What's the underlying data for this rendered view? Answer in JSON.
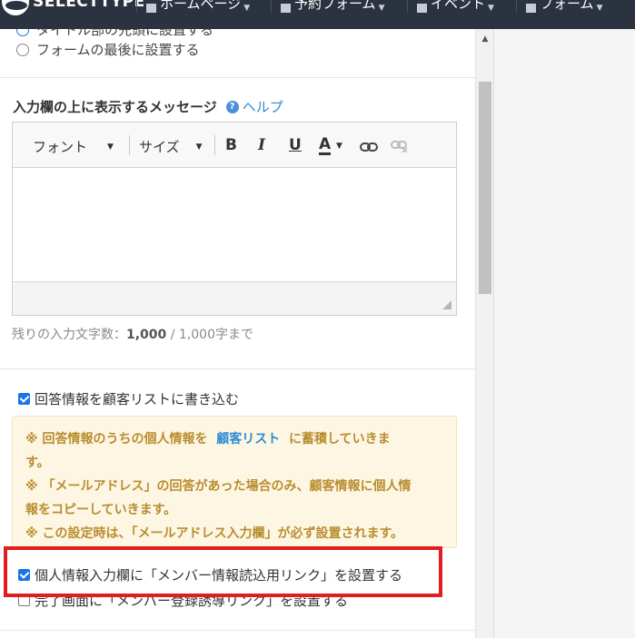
{
  "topbar": {
    "logo_text": "SELECTTYPE",
    "nav": [
      {
        "label": "ホームページ",
        "icon": "page-icon"
      },
      {
        "label": "予約フォーム",
        "icon": "calendar-icon"
      },
      {
        "label": "イベント",
        "icon": "chat-icon"
      },
      {
        "label": "フォーム",
        "icon": "form-icon"
      }
    ]
  },
  "placement": {
    "option_top_partial": "タイトル部の先頭に設置する",
    "option_bottom": "フォームの最後に設置する"
  },
  "message_section": {
    "label": "入力欄の上に表示するメッセージ",
    "help": "ヘルプ"
  },
  "editor": {
    "font_label": "フォント",
    "size_label": "サイズ",
    "bold": "B",
    "italic": "I",
    "underline": "U",
    "color": "A",
    "body": ""
  },
  "counter": {
    "prefix": "残りの入力文字数：",
    "remaining": "1,000",
    "separator": " / ",
    "limit": "1,000字まで"
  },
  "customer": {
    "write_label": "回答情報を顧客リストに書き込む",
    "write_checked": true,
    "notice": {
      "line1_pre": "※ 回答情報のうちの個人情報を",
      "line1_link": "顧客リスト",
      "line1_post": "に蓄積していきま",
      "line2": "す。",
      "line3": "※ 「メールアドレス」の回答があった場合のみ、顧客情報に個人情",
      "line4": "報をコピーしていきます。",
      "line5": "※ この設定時は、「メールアドレス入力欄」が必ず設置されます。"
    },
    "member_link_label": "個人情報入力欄に「メンバー情報読込用リンク」を設置する",
    "member_link_checked": true,
    "complete_label": "完了画面に「メンバー登録誘導リンク」を設置する",
    "complete_checked": false
  },
  "colors": {
    "topbar": "#2b3340",
    "accent": "#1a73e8",
    "highlight": "#e01e1e",
    "notice_text": "#b98d2f"
  }
}
